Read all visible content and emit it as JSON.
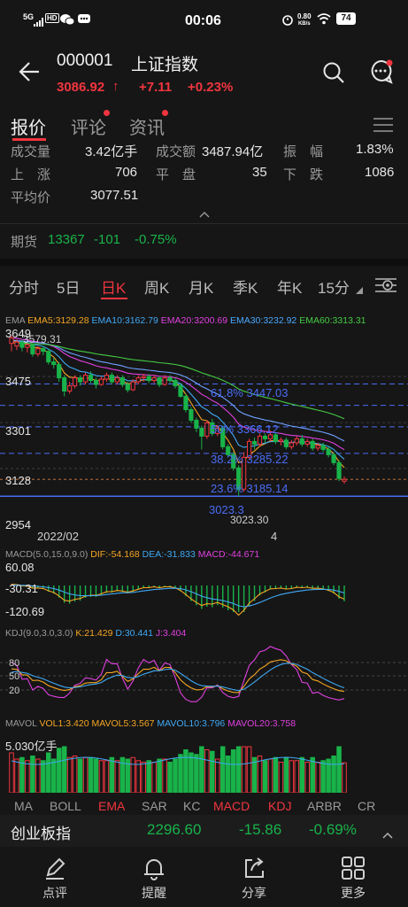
{
  "status_bar": {
    "signal": "5G",
    "hd": "HD",
    "time": "00:06",
    "net_speed": "0.80",
    "net_unit": "KB/s",
    "battery": "74"
  },
  "header": {
    "code": "000001",
    "name": "上证指数",
    "price": "3086.92",
    "arrow": "↑",
    "change": "+7.11",
    "change_pct": "+0.23%"
  },
  "tabs": [
    {
      "label": "报价"
    },
    {
      "label": "评论"
    },
    {
      "label": "资讯"
    }
  ],
  "stats": {
    "volume_label": "成交量",
    "volume": "3.42亿手",
    "amount_label": "成交额",
    "amount": "3487.94亿",
    "amplitude_label": "振　幅",
    "amplitude": "1.83%",
    "up_label": "上　涨",
    "up": "706",
    "flat_label": "平　盘",
    "flat": "35",
    "down_label": "下　跌",
    "down": "1086",
    "avg_label": "平均价",
    "avg": "3077.51"
  },
  "futures": {
    "label": "期货",
    "value": "13367",
    "change": "-101",
    "change_pct": "-0.75%"
  },
  "period_tabs": [
    {
      "label": "分时"
    },
    {
      "label": "5日"
    },
    {
      "label": "日K"
    },
    {
      "label": "周K"
    },
    {
      "label": "月K"
    },
    {
      "label": "季K"
    },
    {
      "label": "年K"
    },
    {
      "label": "15分"
    }
  ],
  "active_period": "日K",
  "ema_legend": {
    "title": "EMA",
    "ema5": "EMA5:3129.28",
    "ema10": "EMA10:3162.79",
    "ema20": "EMA20:3200.69",
    "ema30": "EMA30:3232.92",
    "ema60": "EMA60:3313.31"
  },
  "price_axis": [
    "3649",
    "3475",
    "3301",
    "3128",
    "2954"
  ],
  "price_annotations": {
    "high": "3579.31",
    "low": "3023.30",
    "fib_618": "61.8% 3447.03",
    "fib_50": "50% 3366.12",
    "fib_382": "38.2% 3285.22",
    "fib_236": "23.6% 3185.14",
    "fib_0": "3023.3"
  },
  "date_axis": [
    "2022/02",
    "4"
  ],
  "macd": {
    "title": "MACD(5.0,15.0,9.0)",
    "dif": "DIF:-54.168",
    "dea": "DEA:-31.833",
    "macd": "MACD:-44.671",
    "axis": [
      "60.08",
      "-30.31",
      "-120.69"
    ]
  },
  "kdj": {
    "title": "KDJ(9.0,3.0,3.0)",
    "k": "K:21.429",
    "d": "D:30.441",
    "j": "J:3.404",
    "axis": [
      "80",
      "50",
      "20"
    ]
  },
  "mavol": {
    "title": "MAVOL",
    "vol1": "VOL1:3.420",
    "mavol5": "MAVOL5:3.567",
    "mavol10": "MAVOL10:3.796",
    "mavol20": "MAVOL20:3.758",
    "axis_top": "5.030亿手"
  },
  "indicator_tabs": [
    "MA",
    "BOLL",
    "EMA",
    "SAR",
    "KC",
    "MACD",
    "KDJ",
    "ARBR",
    "CR"
  ],
  "bottom_ticker": {
    "name": "创业板指",
    "value": "2296.60",
    "change": "-15.86",
    "change_pct": "-0.69%"
  },
  "bottom_nav": [
    {
      "label": "点评",
      "icon": "pen-icon"
    },
    {
      "label": "提醒",
      "icon": "bell-icon"
    },
    {
      "label": "分享",
      "icon": "share-icon"
    },
    {
      "label": "更多",
      "icon": "grid-icon"
    }
  ],
  "colors": {
    "up": "#f2353f",
    "down": "#19b34a",
    "ema5": "#f5a623",
    "ema10": "#3fa9f5",
    "ema20": "#e040e0",
    "ema30": "#4aa8ff",
    "ema60": "#44cc44",
    "fib": "#4a6cf7"
  },
  "chart_data": {
    "type": "candlestick",
    "note_series": "daily K-line of Shanghai Composite Index with EMA overlays",
    "ylim": [
      2954,
      3649
    ],
    "high": 3579.31,
    "low": 3023.3,
    "fib_levels": [
      3447.03,
      3366.12,
      3285.22,
      3185.14,
      3023.3
    ],
    "candles": [
      [
        3600,
        3620,
        3570,
        3630
      ],
      [
        3590,
        3605,
        3575,
        3615
      ],
      [
        3605,
        3585,
        3570,
        3615
      ],
      [
        3585,
        3595,
        3565,
        3600
      ],
      [
        3595,
        3560,
        3550,
        3600
      ],
      [
        3560,
        3580,
        3550,
        3590
      ],
      [
        3580,
        3570,
        3555,
        3590
      ],
      [
        3570,
        3530,
        3520,
        3580
      ],
      [
        3530,
        3520,
        3505,
        3545
      ],
      [
        3520,
        3470,
        3455,
        3530
      ],
      [
        3470,
        3420,
        3400,
        3480
      ],
      [
        3420,
        3440,
        3410,
        3455
      ],
      [
        3440,
        3470,
        3430,
        3480
      ],
      [
        3470,
        3455,
        3440,
        3480
      ],
      [
        3455,
        3480,
        3445,
        3490
      ],
      [
        3480,
        3460,
        3450,
        3495
      ],
      [
        3460,
        3445,
        3430,
        3470
      ],
      [
        3445,
        3465,
        3440,
        3475
      ],
      [
        3465,
        3480,
        3455,
        3490
      ],
      [
        3480,
        3455,
        3445,
        3490
      ],
      [
        3455,
        3470,
        3445,
        3480
      ],
      [
        3470,
        3445,
        3435,
        3480
      ],
      [
        3445,
        3425,
        3415,
        3455
      ],
      [
        3425,
        3455,
        3420,
        3465
      ],
      [
        3455,
        3470,
        3445,
        3480
      ],
      [
        3470,
        3475,
        3455,
        3485
      ],
      [
        3475,
        3460,
        3450,
        3485
      ],
      [
        3460,
        3470,
        3450,
        3480
      ],
      [
        3470,
        3445,
        3435,
        3475
      ],
      [
        3445,
        3470,
        3440,
        3480
      ],
      [
        3470,
        3460,
        3450,
        3480
      ],
      [
        3460,
        3440,
        3430,
        3470
      ],
      [
        3440,
        3400,
        3395,
        3450
      ],
      [
        3400,
        3350,
        3340,
        3410
      ],
      [
        3350,
        3310,
        3300,
        3360
      ],
      [
        3310,
        3280,
        3265,
        3320
      ],
      [
        3280,
        3250,
        3200,
        3290
      ],
      [
        3250,
        3300,
        3240,
        3310
      ],
      [
        3300,
        3260,
        3250,
        3315
      ],
      [
        3260,
        3280,
        3250,
        3290
      ],
      [
        3280,
        3210,
        3200,
        3290
      ],
      [
        3210,
        3180,
        3170,
        3220
      ],
      [
        3180,
        3130,
        3120,
        3190
      ],
      [
        3130,
        3050,
        3023,
        3140
      ],
      [
        3050,
        3170,
        3040,
        3190
      ],
      [
        3170,
        3230,
        3160,
        3240
      ],
      [
        3230,
        3220,
        3200,
        3245
      ],
      [
        3220,
        3250,
        3210,
        3260
      ],
      [
        3250,
        3240,
        3225,
        3260
      ],
      [
        3240,
        3255,
        3230,
        3270
      ],
      [
        3255,
        3230,
        3220,
        3265
      ],
      [
        3230,
        3235,
        3215,
        3245
      ],
      [
        3235,
        3210,
        3200,
        3245
      ],
      [
        3210,
        3225,
        3200,
        3235
      ],
      [
        3225,
        3240,
        3215,
        3250
      ],
      [
        3240,
        3220,
        3210,
        3255
      ],
      [
        3220,
        3230,
        3210,
        3240
      ],
      [
        3230,
        3205,
        3195,
        3240
      ],
      [
        3205,
        3215,
        3195,
        3225
      ],
      [
        3215,
        3200,
        3190,
        3225
      ],
      [
        3200,
        3180,
        3170,
        3210
      ],
      [
        3180,
        3150,
        3140,
        3190
      ],
      [
        3150,
        3090,
        3080,
        3160
      ],
      [
        3080,
        3087,
        3070,
        3098
      ]
    ]
  }
}
